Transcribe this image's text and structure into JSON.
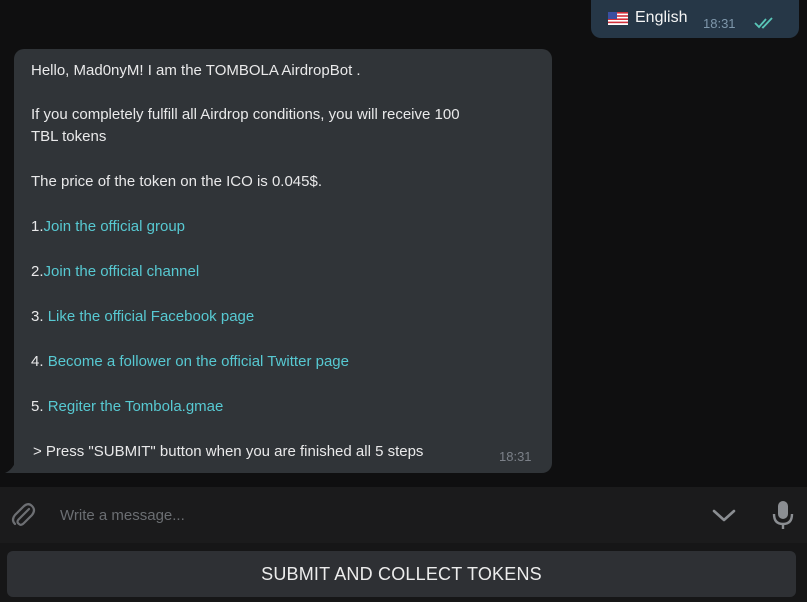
{
  "outgoing": {
    "flag_icon": "us-flag-icon",
    "text": "English",
    "time": "18:31",
    "status_icon": "double-check-icon"
  },
  "incoming": {
    "greeting": "Hello, Mad0nyM! I am the TOMBOLA AirdropBot .",
    "conditions_line1": "If you completely fulfill all Airdrop conditions, you will receive 100",
    "conditions_line2": "TBL tokens",
    "price": "The price of the token on the ICO is 0.045$.",
    "steps": [
      {
        "num": "1.",
        "link": "Join the official group"
      },
      {
        "num": "2.",
        "link": "Join the official channel"
      },
      {
        "num": "3.",
        "link": "Like the official Facebook page"
      },
      {
        "num": "4.",
        "link": "Become a follower on the official Twitter page"
      },
      {
        "num": "5.",
        "link": "Regiter the Tombola.gmae"
      }
    ],
    "footer": "> Press \"SUBMIT\" button when you are finished all 5 steps",
    "time": "18:31"
  },
  "composer": {
    "placeholder": "Write a message...",
    "attach_icon": "paperclip-icon",
    "keyboard_icon": "chevron-down-icon",
    "mic_icon": "microphone-icon"
  },
  "keyboard": {
    "button_label": "SUBMIT AND COLLECT TOKENS"
  },
  "colors": {
    "link": "#57c9d2",
    "bubble_in": "#303438",
    "bubble_out": "#263747",
    "check": "#59c6b8"
  }
}
